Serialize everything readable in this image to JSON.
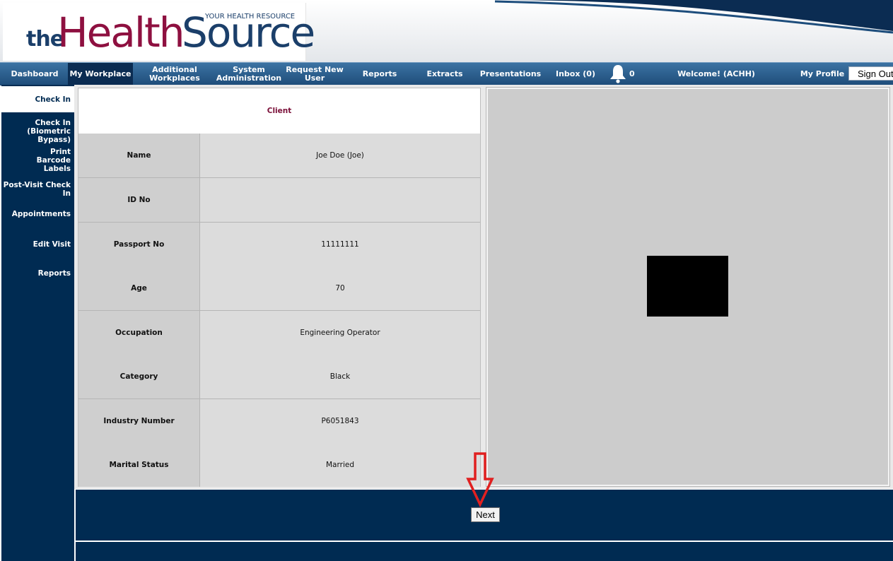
{
  "header": {
    "logo_the": "the",
    "logo_health": "Health",
    "logo_source": "Source",
    "logo_tagline": "YOUR HEALTH RESOURCE"
  },
  "nav": {
    "items": [
      {
        "label": "Dashboard"
      },
      {
        "label": "My Workplace"
      },
      {
        "label": "Additional Workplaces"
      },
      {
        "label": "System Administration"
      },
      {
        "label": "Request New User"
      },
      {
        "label": "Reports"
      },
      {
        "label": "Extracts"
      },
      {
        "label": "Presentations"
      },
      {
        "label": "Inbox (0)"
      }
    ],
    "bell_count": "0",
    "welcome": "Welcome! (ACHH)",
    "my_profile": "My Profile",
    "sign_out": "Sign Out"
  },
  "sidebar": {
    "items": [
      {
        "label": "Check In"
      },
      {
        "label": "Check In (Biometric Bypass)"
      },
      {
        "label": "Print Barcode Labels"
      },
      {
        "label": "Post-Visit Check In"
      },
      {
        "label": "Appointments"
      },
      {
        "label": "Edit Visit"
      },
      {
        "label": "Reports"
      }
    ]
  },
  "client": {
    "heading": "Client",
    "rows": [
      {
        "label": "Name",
        "value": "Joe Doe (Joe)"
      },
      {
        "label": "ID No",
        "value": ""
      },
      {
        "label": "Passport No",
        "value": "11111111"
      },
      {
        "label": "Age",
        "value": "70"
      },
      {
        "label": "Occupation",
        "value": "Engineering Operator"
      },
      {
        "label": "Category",
        "value": "Black"
      },
      {
        "label": "Industry Number",
        "value": "P6051843"
      },
      {
        "label": "Marital Status",
        "value": "Married"
      }
    ]
  },
  "footer": {
    "next_label": "Next"
  },
  "colors": {
    "navy": "#002b52",
    "brand_maroon": "#8e1040",
    "annotation_red": "#e02020"
  }
}
